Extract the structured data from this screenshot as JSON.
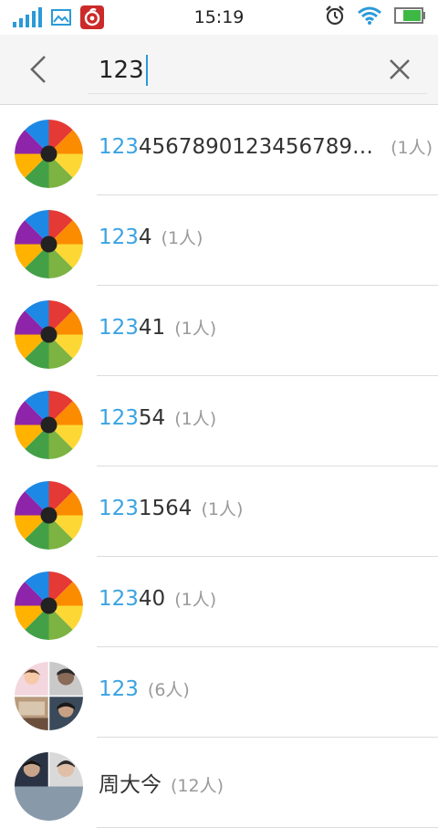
{
  "status_bar": {
    "time": "15:19",
    "icons": [
      "signal-icon",
      "gallery-icon",
      "netease-music-icon",
      "alarm-icon",
      "wifi-icon",
      "battery-icon"
    ]
  },
  "search": {
    "value": "123"
  },
  "colors": {
    "highlight": "#3aa3e3",
    "text": "#333333",
    "count": "#9a9a9a",
    "caret": "#2b9ad8"
  },
  "results": [
    {
      "match": "123",
      "rest": "45678901234567890...",
      "count": "(1人)"
    },
    {
      "match": "123",
      "rest": "4",
      "count": "(1人)"
    },
    {
      "match": "123",
      "rest": "41",
      "count": "(1人)"
    },
    {
      "match": "123",
      "rest": "54",
      "count": "(1人)"
    },
    {
      "match": "123",
      "rest": "1564",
      "count": "(1人)"
    },
    {
      "match": "123",
      "rest": "40",
      "count": "(1人)"
    },
    {
      "match": "123",
      "rest": "",
      "count": "(6人)"
    },
    {
      "match": "",
      "rest": "周大今",
      "count": "(12人)"
    }
  ]
}
